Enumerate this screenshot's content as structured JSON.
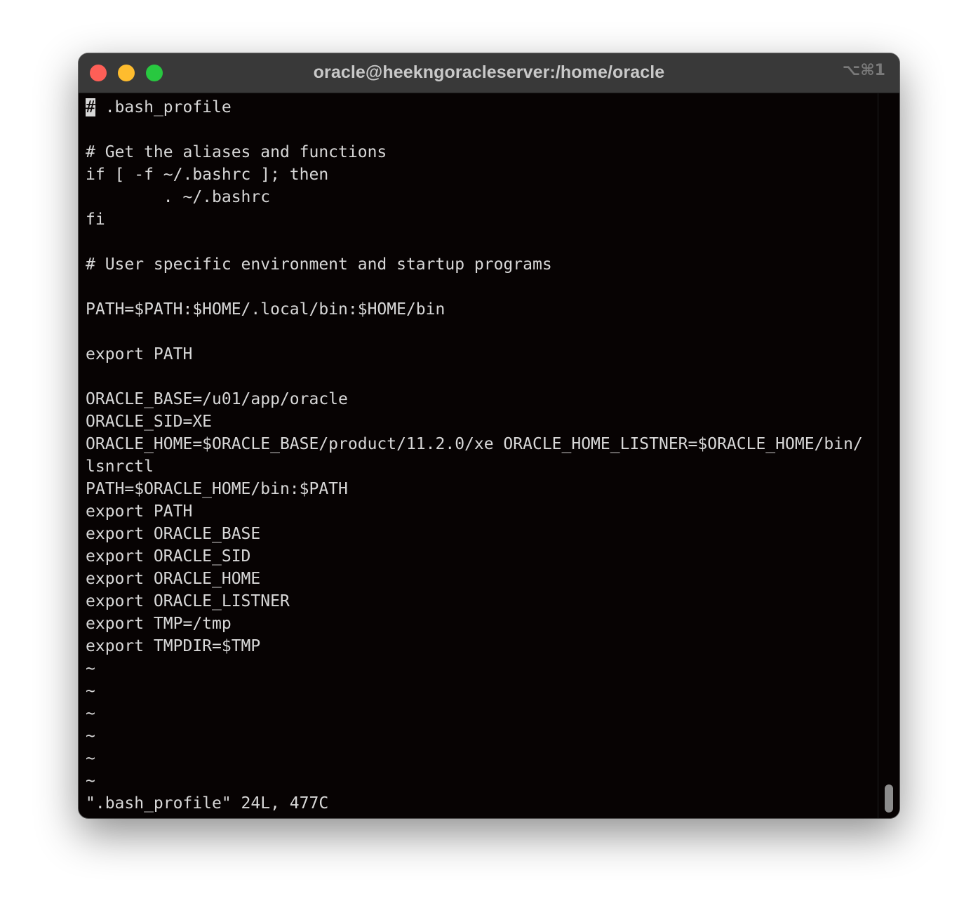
{
  "window": {
    "title": "oracle@heekngoracleserver:/home/oracle",
    "shortcut": "⌥⌘1"
  },
  "editor": {
    "cursor_char": "#",
    "first_line_rest": " .bash_profile",
    "lines": [
      "",
      "# Get the aliases and functions",
      "if [ -f ~/.bashrc ]; then",
      "        . ~/.bashrc",
      "fi",
      "",
      "# User specific environment and startup programs",
      "",
      "PATH=$PATH:$HOME/.local/bin:$HOME/bin",
      "",
      "export PATH",
      "",
      "ORACLE_BASE=/u01/app/oracle",
      "ORACLE_SID=XE",
      "ORACLE_HOME=$ORACLE_BASE/product/11.2.0/xe ORACLE_HOME_LISTNER=$ORACLE_HOME/bin/",
      "lsnrctl",
      "PATH=$ORACLE_HOME/bin:$PATH",
      "export PATH",
      "export ORACLE_BASE",
      "export ORACLE_SID",
      "export ORACLE_HOME",
      "export ORACLE_LISTNER",
      "export TMP=/tmp",
      "export TMPDIR=$TMP",
      "~",
      "~",
      "~",
      "~",
      "~",
      "~"
    ],
    "status_line": "\".bash_profile\" 24L, 477C"
  },
  "colors": {
    "background": "#070303",
    "text": "#d8d8d8",
    "titlebar": "#393939",
    "close": "#fe5f57",
    "minimize": "#febc2e",
    "maximize": "#28c840"
  }
}
